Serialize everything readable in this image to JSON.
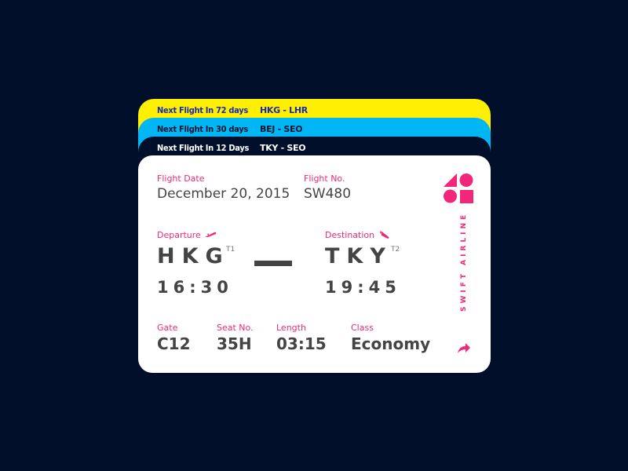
{
  "tabs": [
    {
      "label": "Next Flight In 72 days",
      "route": "HKG - LHR",
      "color": "#ffef00"
    },
    {
      "label": "Next Flight In 30 days",
      "route": "BEJ - SEO",
      "color": "#00b6f5"
    },
    {
      "label": "Next Flight In 12 Days",
      "route": "TKY - SEO",
      "color": "#020f2b"
    }
  ],
  "ticket": {
    "flight_date_label": "Flight Date",
    "flight_date": "December 20, 2015",
    "flight_no_label": "Flight No.",
    "flight_no": "SW480",
    "departure_label": "Departure",
    "departure_code": "HKG",
    "departure_terminal": "T1",
    "departure_time": "16:30",
    "destination_label": "Destination",
    "destination_code": "TKY",
    "destination_terminal": "T2",
    "destination_time": "19:45",
    "gate_label": "Gate",
    "gate": "C12",
    "seat_label": "Seat No.",
    "seat": "35H",
    "length_label": "Length",
    "length": "03:15",
    "class_label": "Class",
    "class": "Economy",
    "airline": "SWIFT AIRLINE",
    "accent_color": "#f2277a"
  }
}
